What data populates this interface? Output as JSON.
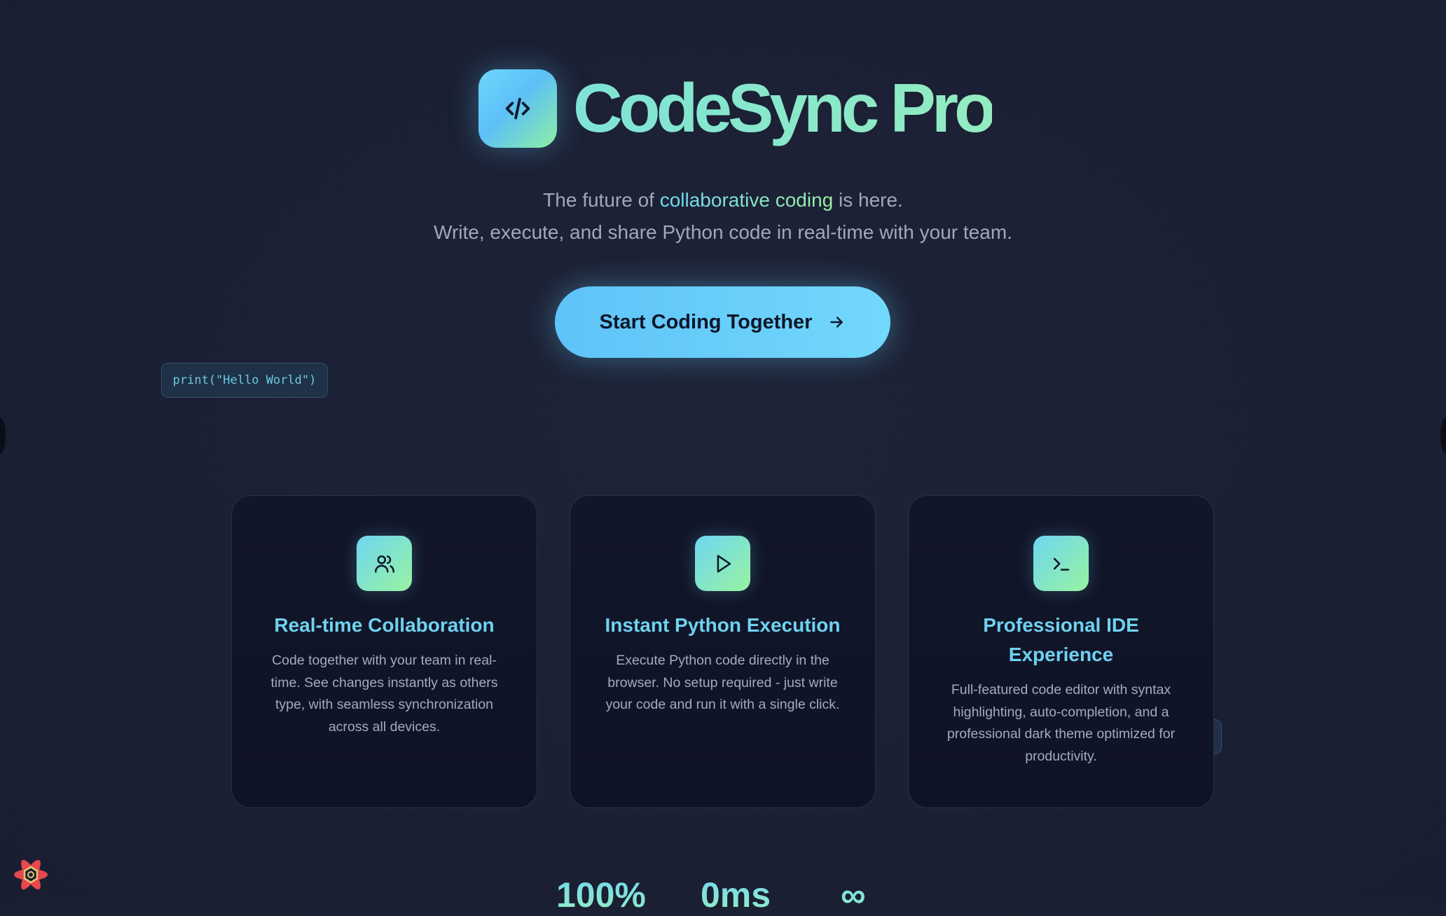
{
  "hero": {
    "title": "CodeSync Pro",
    "logo_icon": "code-icon",
    "subtitle_prefix": "The future of ",
    "subtitle_highlight": "collaborative coding",
    "subtitle_suffix": " is here.",
    "subtitle_line2": "Write, execute, and share Python code in real-time with your team.",
    "cta_label": "Start Coding Together",
    "cta_icon": "arrow-right-icon"
  },
  "floating_code": "print(\"Hello World\")",
  "features": [
    {
      "icon": "users-icon",
      "title": "Real-time Collaboration",
      "description": "Code together with your team in real-time. See changes instantly as others type, with seamless synchronization across all devices."
    },
    {
      "icon": "play-icon",
      "title": "Instant Python Execution",
      "description": "Execute Python code directly in the browser. No setup required - just write your code and run it with a single click."
    },
    {
      "icon": "terminal-icon",
      "title": "Professional IDE Experience",
      "description": "Full-featured code editor with syntax highlighting, auto-completion, and a professional dark theme optimized for productivity."
    }
  ],
  "stats": [
    "100%",
    "0ms",
    "∞"
  ],
  "colors": {
    "background": "#1b2034",
    "accent_blue": "#5ec3f8",
    "accent_green": "#8ef0a2",
    "card_bg": "#111528"
  }
}
